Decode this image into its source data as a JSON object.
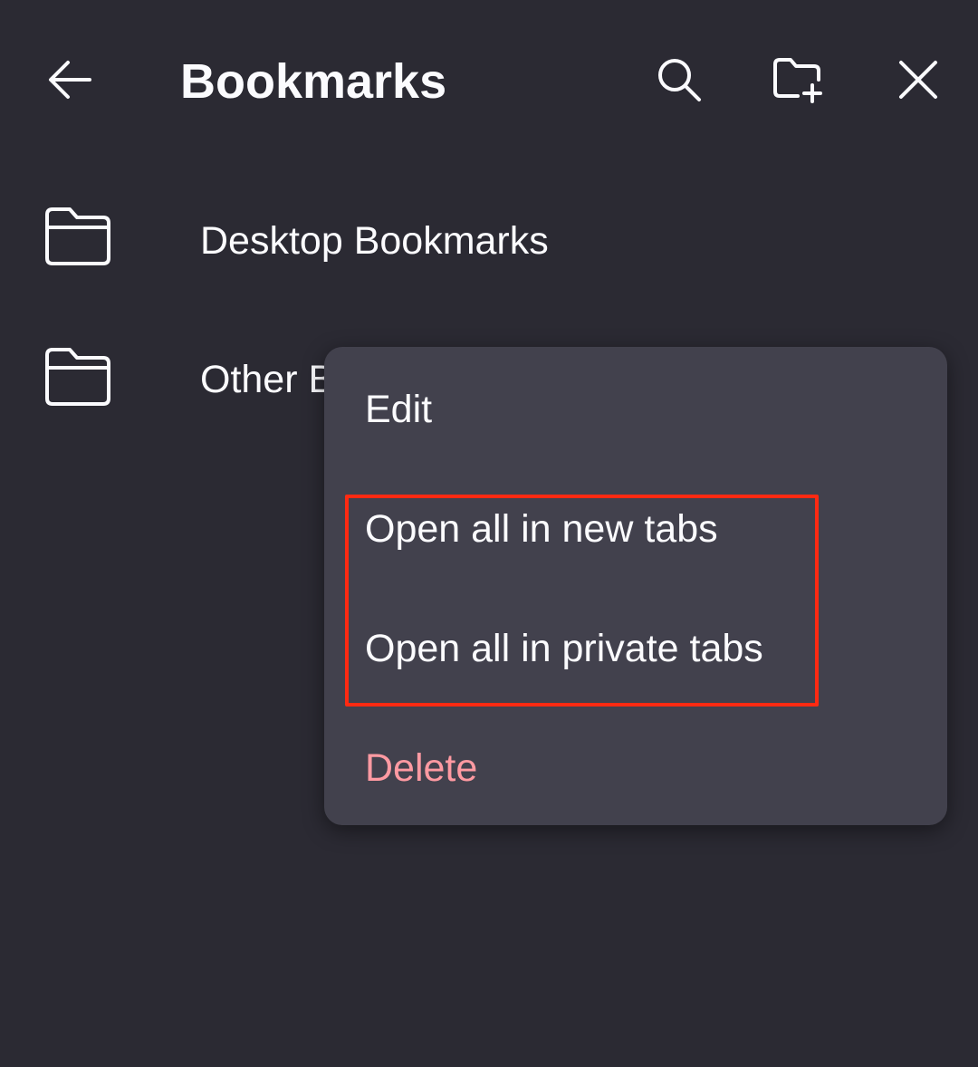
{
  "toolbar": {
    "title": "Bookmarks",
    "back_icon": "arrow-left-icon",
    "search_icon": "search-icon",
    "new_folder_icon": "folder-add-icon",
    "close_icon": "close-icon"
  },
  "bookmarks": {
    "items": [
      {
        "label": "Desktop Bookmarks",
        "icon": "folder-icon"
      },
      {
        "label": "Other B",
        "icon": "folder-icon"
      }
    ]
  },
  "context_menu": {
    "edit": "Edit",
    "open_new_tabs": "Open all in new tabs",
    "open_private_tabs": "Open all in private tabs",
    "delete": "Delete"
  },
  "colors": {
    "background": "#2b2a33",
    "menu_background": "#42414d",
    "text": "#fbfbfe",
    "destructive": "#ff9aa2",
    "highlight_border": "#ff2a12"
  }
}
